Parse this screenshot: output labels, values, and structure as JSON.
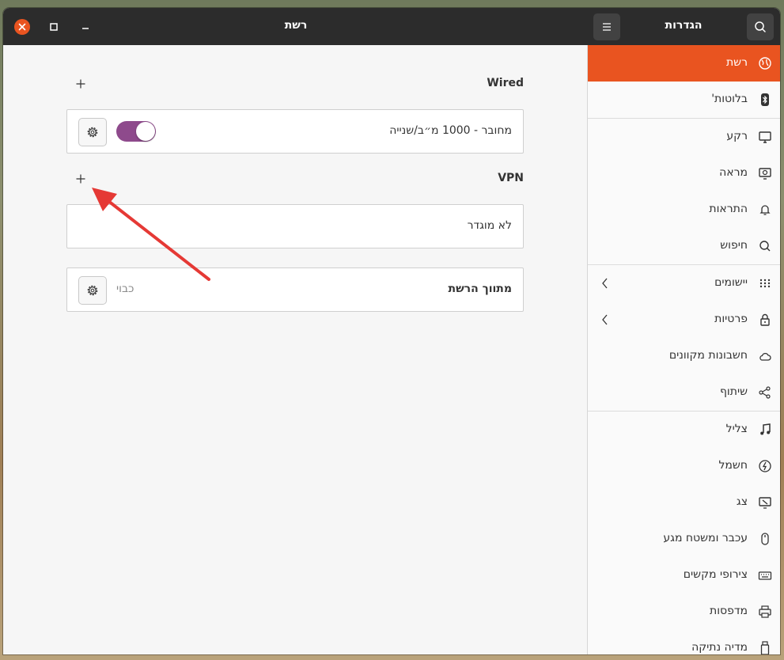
{
  "window": {
    "title": "רשת",
    "sidebar_title": "הגדרות"
  },
  "wired": {
    "title": "Wired",
    "status": "מחובר - 1000 מ״ב/שנייה",
    "toggle_on": true
  },
  "vpn": {
    "title": "VPN",
    "status": "לא מוגדר"
  },
  "proxy": {
    "label": "מתווך הרשת",
    "status": "כבוי"
  },
  "sidebar": {
    "items": [
      {
        "label": "רשת",
        "icon": "globe-icon",
        "active": true
      },
      {
        "label": "בלוטות'",
        "icon": "bluetooth-icon"
      },
      {
        "label": "רקע",
        "icon": "monitor-icon"
      },
      {
        "label": "מראה",
        "icon": "appearance-icon"
      },
      {
        "label": "התראות",
        "icon": "bell-icon"
      },
      {
        "label": "חיפוש",
        "icon": "search-icon"
      },
      {
        "label": "יישומים",
        "icon": "apps-grid-icon",
        "has_submenu": true
      },
      {
        "label": "פרטיות",
        "icon": "lock-icon",
        "has_submenu": true
      },
      {
        "label": "חשבונות מקוונים",
        "icon": "cloud-icon"
      },
      {
        "label": "שיתוף",
        "icon": "share-icon"
      },
      {
        "label": "צליל",
        "icon": "music-note-icon"
      },
      {
        "label": "חשמל",
        "icon": "power-icon"
      },
      {
        "label": "צג",
        "icon": "display-icon"
      },
      {
        "label": "עכבר ומשטח מגע",
        "icon": "mouse-icon"
      },
      {
        "label": "צירופי מקשים",
        "icon": "keyboard-icon"
      },
      {
        "label": "מדפסות",
        "icon": "printer-icon"
      },
      {
        "label": "מדיה נתיקה",
        "icon": "usb-drive-icon"
      }
    ]
  },
  "colors": {
    "accent": "#e95420",
    "toggle": "#8e4a8c",
    "titlebar": "#2c2c2c",
    "arrow": "#e53935"
  }
}
